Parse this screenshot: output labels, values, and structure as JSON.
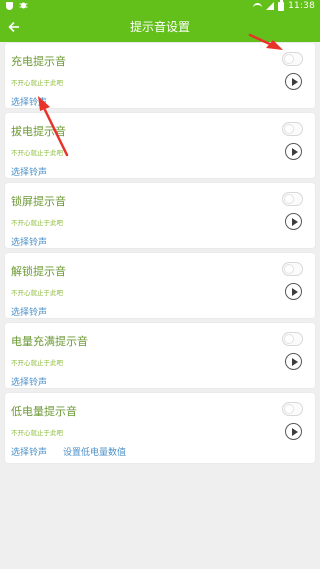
{
  "status_bar": {
    "time": "11:38",
    "left_icons": [
      "shield-icon",
      "bug-icon"
    ],
    "right_icons": [
      "wifi-icon",
      "signal-icon",
      "battery-icon"
    ]
  },
  "app_bar": {
    "title": "提示音设置",
    "back_icon": "arrow-left-icon"
  },
  "cards": [
    {
      "title": "充电提示音",
      "hint": "不开心就止于此吧",
      "links": [
        "选择铃声"
      ],
      "enabled": false
    },
    {
      "title": "拔电提示音",
      "hint": "不开心就止于此吧",
      "links": [
        "选择铃声"
      ],
      "enabled": false
    },
    {
      "title": "锁屏提示音",
      "hint": "不开心就止于此吧",
      "links": [
        "选择铃声"
      ],
      "enabled": false
    },
    {
      "title": "解锁提示音",
      "hint": "不开心就止于此吧",
      "links": [
        "选择铃声"
      ],
      "enabled": false
    },
    {
      "title": "电量充满提示音",
      "hint": "不开心就止于此吧",
      "links": [
        "选择铃声"
      ],
      "enabled": false
    },
    {
      "title": "低电量提示音",
      "hint": "不开心就止于此吧",
      "links": [
        "选择铃声",
        "设置低电量数值"
      ],
      "enabled": false
    }
  ],
  "colors": {
    "primary": "#63bf1a",
    "title_text": "#6b9a35",
    "hint_text": "#8cbd3d",
    "link_text": "#4c90c8",
    "annotation_arrow": "#e8332a"
  }
}
